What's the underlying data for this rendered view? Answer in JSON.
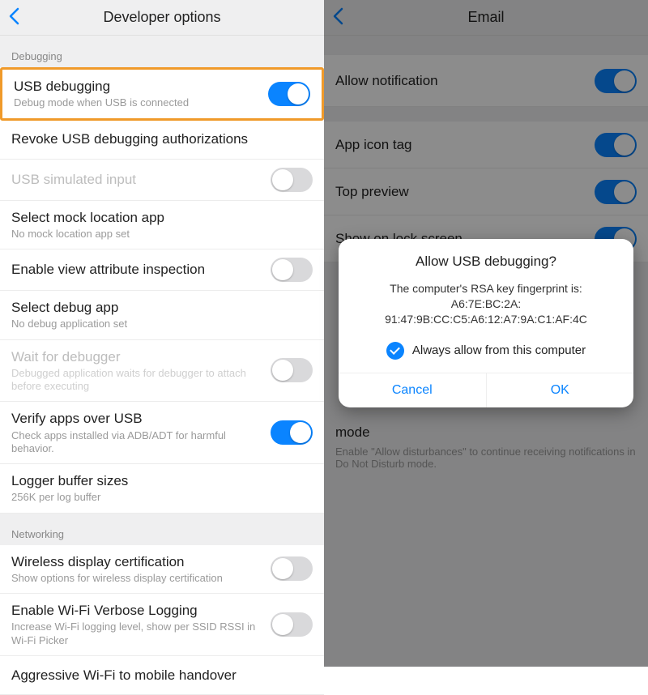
{
  "left": {
    "header": {
      "title": "Developer options"
    },
    "sections": {
      "debugging_label": "Debugging",
      "networking_label": "Networking"
    },
    "rows": {
      "usb_debugging": {
        "title": "USB debugging",
        "sub": "Debug mode when USB is connected"
      },
      "revoke": {
        "title": "Revoke USB debugging authorizations"
      },
      "usb_sim": {
        "title": "USB simulated input"
      },
      "mock_loc": {
        "title": "Select mock location app",
        "sub": "No mock location app set"
      },
      "view_attr": {
        "title": "Enable view attribute inspection"
      },
      "debug_app": {
        "title": "Select debug app",
        "sub": "No debug application set"
      },
      "wait_dbg": {
        "title": "Wait for debugger",
        "sub": "Debugged application waits for debugger to attach before executing"
      },
      "verify": {
        "title": "Verify apps over USB",
        "sub": "Check apps installed via ADB/ADT for harmful behavior."
      },
      "logger": {
        "title": "Logger buffer sizes",
        "sub": "256K per log buffer"
      },
      "wireless": {
        "title": "Wireless display certification",
        "sub": "Show options for wireless display certification"
      },
      "wifi_verbose": {
        "title": "Enable Wi-Fi Verbose Logging",
        "sub": "Increase Wi-Fi logging level, show per SSID RSSI in Wi-Fi Picker"
      },
      "aggressive": {
        "title": "Aggressive Wi-Fi to mobile handover"
      }
    }
  },
  "right": {
    "header": {
      "title": "Email"
    },
    "rows": {
      "allow_notif": {
        "title": "Allow notification"
      },
      "app_icon": {
        "title": "App icon tag"
      },
      "top_preview": {
        "title": "Top preview"
      },
      "lock_screen": {
        "title": "Show on lock screen"
      }
    },
    "below": {
      "mode_title": "mode",
      "mode_sub": "Enable \"Allow disturbances\" to continue receiving notifications in Do Not Disturb mode."
    },
    "dialog": {
      "title": "Allow USB debugging?",
      "line1": "The computer's RSA key fingerprint is:",
      "line2": "A6:7E:BC:2A:",
      "line3": "91:47:9B:CC:C5:A6:12:A7:9A:C1:AF:4C",
      "check_label": "Always allow from this computer",
      "cancel": "Cancel",
      "ok": "OK"
    }
  }
}
